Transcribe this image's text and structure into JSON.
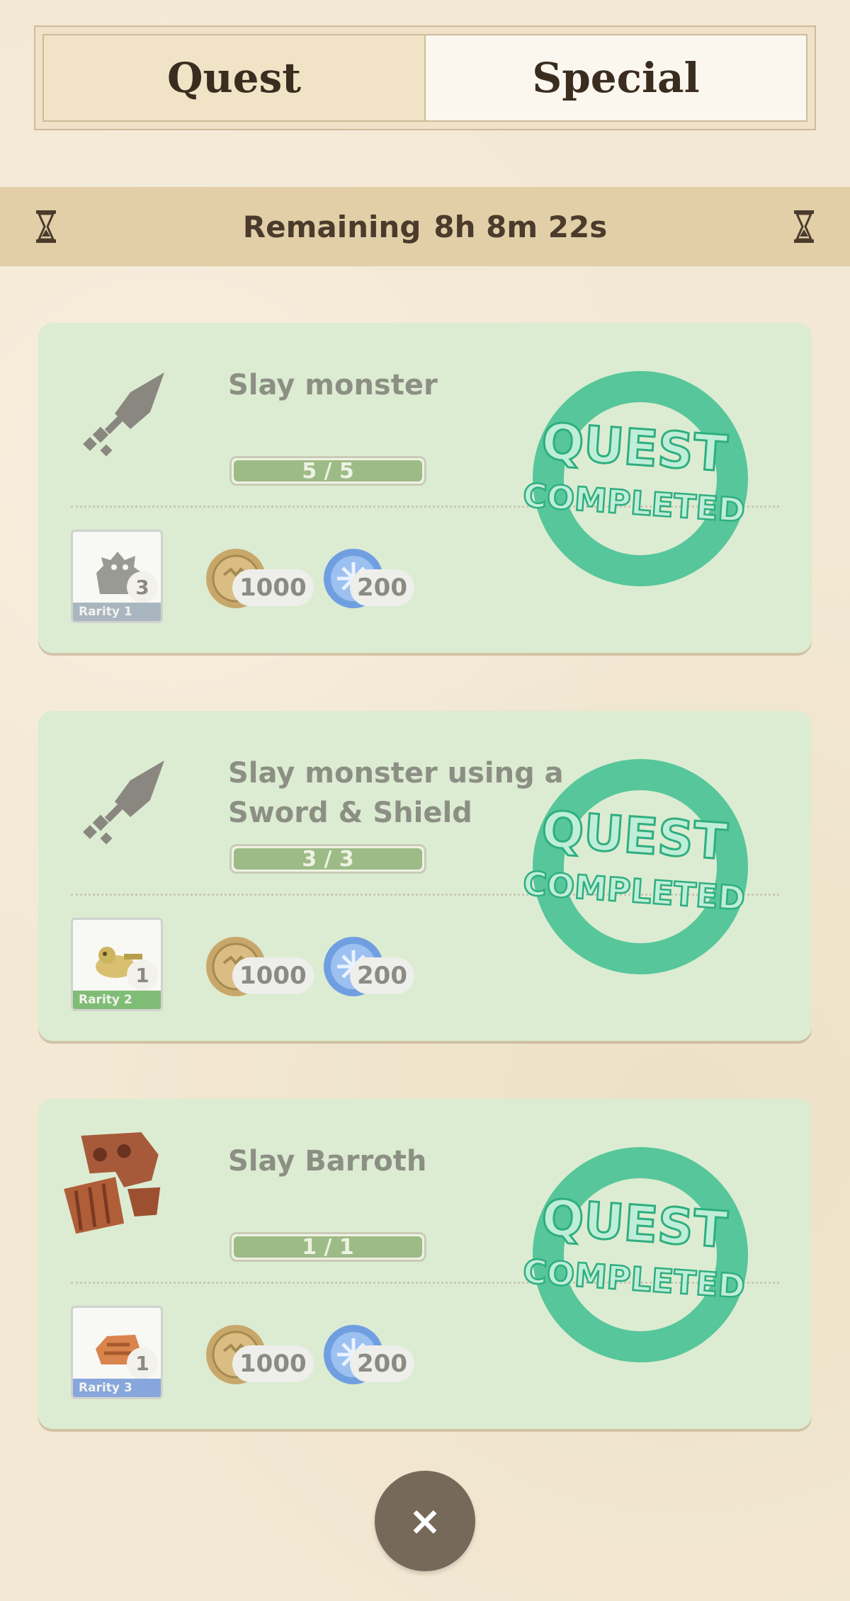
{
  "tabs": {
    "quest": "Quest",
    "special": "Special"
  },
  "timer": {
    "label": "Remaining",
    "value": "8h 8m 22s"
  },
  "quests": [
    {
      "title": "Slay monster",
      "progress_text": "5 / 5",
      "progress": 1.0,
      "icon": "sword-icon",
      "item": {
        "count": "3",
        "rarity": "Rarity 1",
        "rarity_color": "#a9b6c0"
      },
      "rewards": {
        "zenny": "1000",
        "points": "200"
      },
      "stamp": {
        "line1": "QUEST",
        "line2": "COMPLETED"
      }
    },
    {
      "title": "Slay monster using a Sword & Shield",
      "progress_text": "3 / 3",
      "progress": 1.0,
      "icon": "sword-icon",
      "item": {
        "count": "1",
        "rarity": "Rarity 2",
        "rarity_color": "#7fbd76"
      },
      "rewards": {
        "zenny": "1000",
        "points": "200"
      },
      "stamp": {
        "line1": "QUEST",
        "line2": "COMPLETED"
      }
    },
    {
      "title": "Slay Barroth",
      "progress_text": "1 / 1",
      "progress": 1.0,
      "icon": "barroth-icon",
      "item": {
        "count": "1",
        "rarity": "Rarity 3",
        "rarity_color": "#86a6dc"
      },
      "rewards": {
        "zenny": "1000",
        "points": "200"
      },
      "stamp": {
        "line1": "QUEST",
        "line2": "COMPLETED"
      }
    }
  ],
  "close": {
    "label": "×"
  },
  "colors": {
    "card_bg": "#dcecd2",
    "stamp": "#3fbf90",
    "progress": "#9dbb86"
  }
}
